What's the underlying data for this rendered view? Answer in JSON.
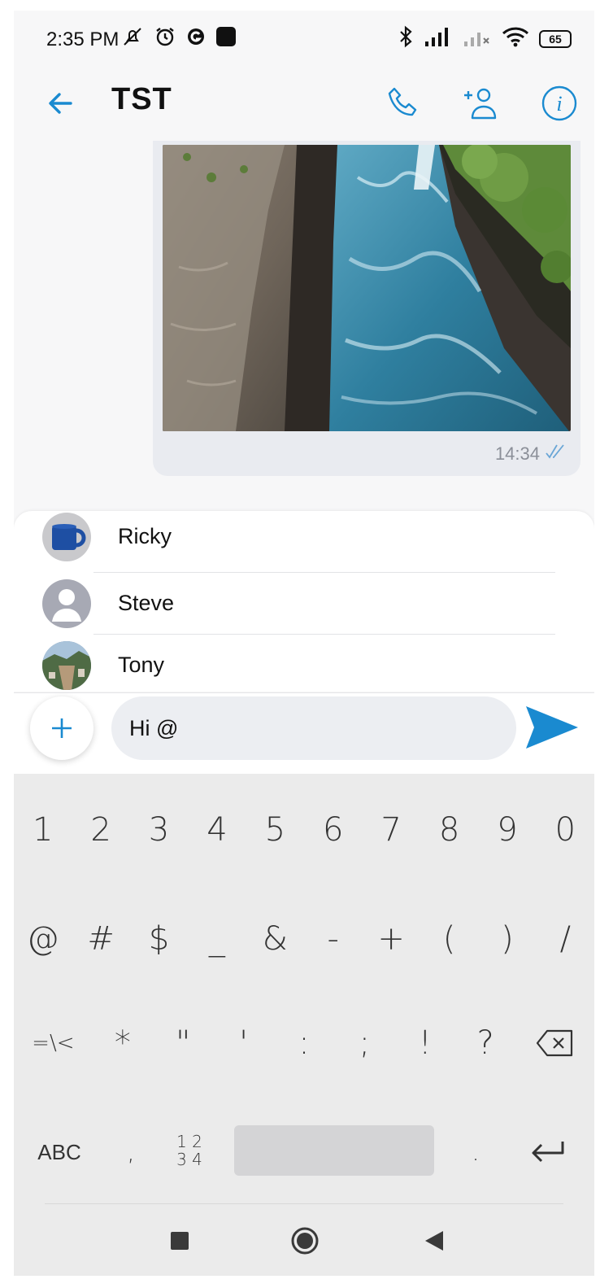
{
  "status_bar": {
    "time": "2:35 PM",
    "battery": "65",
    "icons": [
      "muted-icon",
      "alarm-icon",
      "g-icon",
      "app-icon",
      "bluetooth-icon",
      "signal-icon",
      "signal-2-icon",
      "wifi-icon",
      "battery-icon"
    ]
  },
  "header": {
    "title": "TST",
    "icons": [
      "back-arrow-icon",
      "phone-icon",
      "add-user-icon",
      "info-icon"
    ]
  },
  "message": {
    "time": "14:34",
    "status_icon": "double-check-icon"
  },
  "mentions": [
    {
      "name": "Ricky"
    },
    {
      "name": "Steve"
    },
    {
      "name": "Tony"
    }
  ],
  "composer": {
    "value": "Hi @"
  },
  "keyboard": {
    "row1": [
      "1",
      "2",
      "3",
      "4",
      "5",
      "6",
      "7",
      "8",
      "9",
      "0"
    ],
    "row2": [
      "@",
      "#",
      "$",
      "_",
      "&",
      "-",
      "+",
      "(",
      ")",
      "/"
    ],
    "row3": [
      "=\\<",
      "*",
      "\"",
      "'",
      ":",
      ";",
      "!",
      "?"
    ],
    "row4": {
      "abc": "ABC",
      "comma": ",",
      "num_top": "1 2",
      "num_bottom": "3 4",
      "period": "."
    }
  },
  "colors": {
    "accent": "#1a8ad0",
    "bubble": "#e9ebf0",
    "keyboard_bg": "#ebebeb"
  }
}
